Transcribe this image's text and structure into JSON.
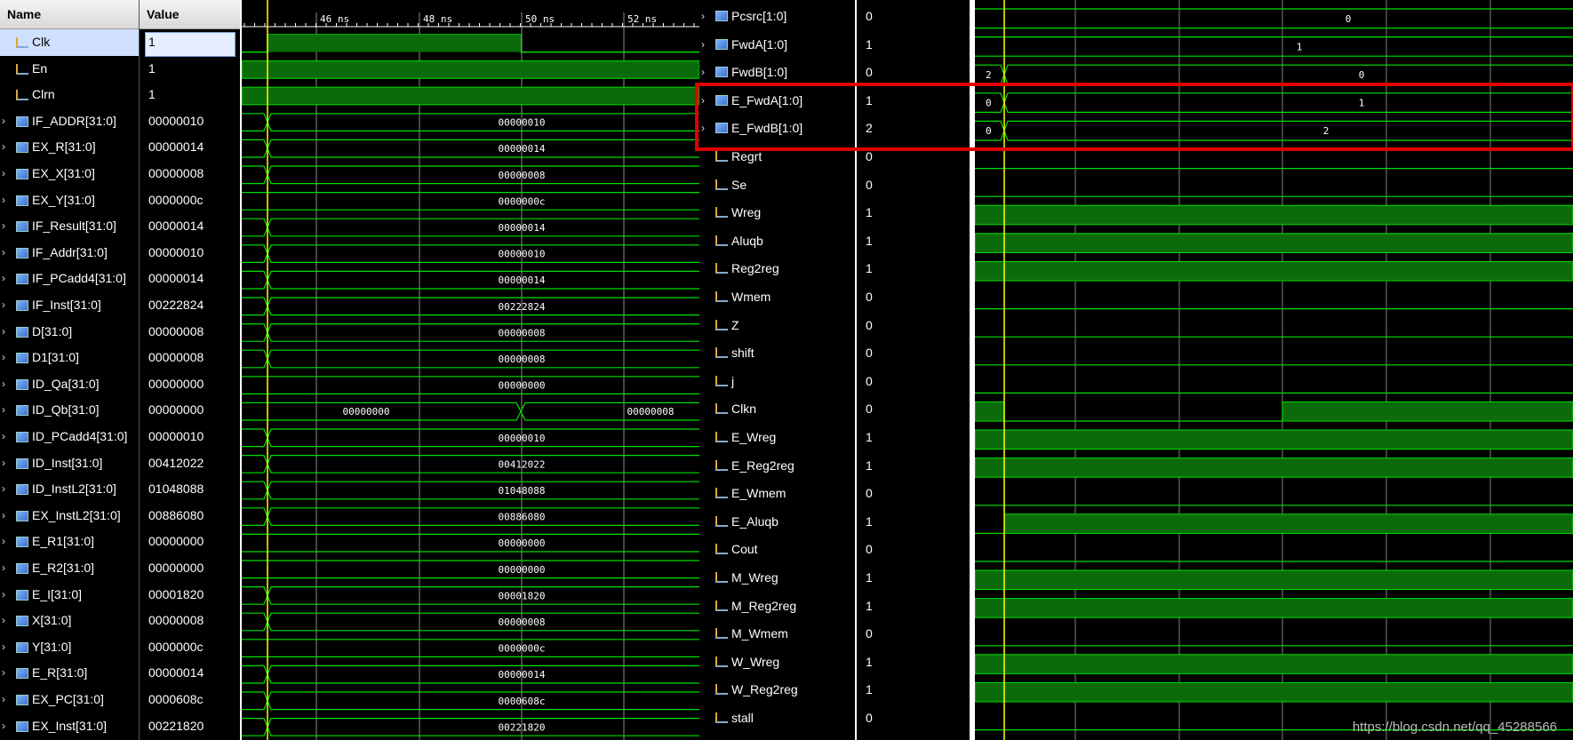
{
  "header": {
    "name_label": "Name",
    "value_label": "Value"
  },
  "timeline": {
    "ticks": [
      "46 ns",
      "48 ns",
      "50 ns",
      "52 ns"
    ]
  },
  "left_signals": [
    {
      "name": "Clk",
      "value": "1",
      "bus": false,
      "selected": true,
      "kind": "clk"
    },
    {
      "name": "En",
      "value": "1",
      "bus": false,
      "kind": "high"
    },
    {
      "name": "Clrn",
      "value": "1",
      "bus": false,
      "kind": "high"
    },
    {
      "name": "IF_ADDR[31:0]",
      "value": "00000010",
      "bus": true,
      "label": "00000010",
      "transition": true
    },
    {
      "name": "EX_R[31:0]",
      "value": "00000014",
      "bus": true,
      "label": "00000014",
      "transition": true
    },
    {
      "name": "EX_X[31:0]",
      "value": "00000008",
      "bus": true,
      "label": "00000008",
      "transition": true
    },
    {
      "name": "EX_Y[31:0]",
      "value": "0000000c",
      "bus": true,
      "label": "0000000c",
      "transition": false
    },
    {
      "name": "IF_Result[31:0]",
      "value": "00000014",
      "bus": true,
      "label": "00000014",
      "transition": true
    },
    {
      "name": "IF_Addr[31:0]",
      "value": "00000010",
      "bus": true,
      "label": "00000010",
      "transition": true
    },
    {
      "name": "IF_PCadd4[31:0]",
      "value": "00000014",
      "bus": true,
      "label": "00000014",
      "transition": true
    },
    {
      "name": "IF_Inst[31:0]",
      "value": "00222824",
      "bus": true,
      "label": "00222824",
      "transition": true
    },
    {
      "name": "D[31:0]",
      "value": "00000008",
      "bus": true,
      "label": "00000008",
      "transition": true
    },
    {
      "name": "D1[31:0]",
      "value": "00000008",
      "bus": true,
      "label": "00000008",
      "transition": true
    },
    {
      "name": "ID_Qa[31:0]",
      "value": "00000000",
      "bus": true,
      "label": "00000000",
      "transition": false
    },
    {
      "name": "ID_Qb[31:0]",
      "value": "00000000",
      "bus": true,
      "label": "00000000",
      "label2": "00000008",
      "split": true
    },
    {
      "name": "ID_PCadd4[31:0]",
      "value": "00000010",
      "bus": true,
      "label": "00000010",
      "transition": true
    },
    {
      "name": "ID_Inst[31:0]",
      "value": "00412022",
      "bus": true,
      "label": "00412022",
      "transition": true
    },
    {
      "name": "ID_InstL2[31:0]",
      "value": "01048088",
      "bus": true,
      "label": "01048088",
      "transition": true
    },
    {
      "name": "EX_InstL2[31:0]",
      "value": "00886080",
      "bus": true,
      "label": "00886080",
      "transition": true
    },
    {
      "name": "E_R1[31:0]",
      "value": "00000000",
      "bus": true,
      "label": "00000000",
      "transition": false
    },
    {
      "name": "E_R2[31:0]",
      "value": "00000000",
      "bus": true,
      "label": "00000000",
      "transition": false
    },
    {
      "name": "E_I[31:0]",
      "value": "00001820",
      "bus": true,
      "label": "00001820",
      "transition": true
    },
    {
      "name": "X[31:0]",
      "value": "00000008",
      "bus": true,
      "label": "00000008",
      "transition": true
    },
    {
      "name": "Y[31:0]",
      "value": "0000000c",
      "bus": true,
      "label": "0000000c",
      "transition": false
    },
    {
      "name": "E_R[31:0]",
      "value": "00000014",
      "bus": true,
      "label": "00000014",
      "transition": true
    },
    {
      "name": "EX_PC[31:0]",
      "value": "0000608c",
      "bus": true,
      "label": "0000608c",
      "transition": true
    },
    {
      "name": "EX_Inst[31:0]",
      "value": "00221820",
      "bus": true,
      "label": "00221820",
      "transition": true
    }
  ],
  "right_signals": [
    {
      "name": "Pcsrc[1:0]",
      "value": "0",
      "bus": true,
      "label": "0"
    },
    {
      "name": "FwdA[1:0]",
      "value": "1",
      "bus": true,
      "label": "1"
    },
    {
      "name": "FwdB[1:0]",
      "value": "0",
      "bus": true,
      "label": "0",
      "pre": "2"
    },
    {
      "name": "E_FwdA[1:0]",
      "value": "1",
      "bus": true,
      "label": "1",
      "pre": "0"
    },
    {
      "name": "E_FwdB[1:0]",
      "value": "2",
      "bus": true,
      "label": "2",
      "pre": "0"
    },
    {
      "name": "Regrt",
      "value": "0",
      "bus": false,
      "kind": "low"
    },
    {
      "name": "Se",
      "value": "0",
      "bus": false,
      "kind": "low"
    },
    {
      "name": "Wreg",
      "value": "1",
      "bus": false,
      "kind": "high"
    },
    {
      "name": "Aluqb",
      "value": "1",
      "bus": false,
      "kind": "high"
    },
    {
      "name": "Reg2reg",
      "value": "1",
      "bus": false,
      "kind": "high"
    },
    {
      "name": "Wmem",
      "value": "0",
      "bus": false,
      "kind": "low"
    },
    {
      "name": "Z",
      "value": "0",
      "bus": false,
      "kind": "low"
    },
    {
      "name": "shift",
      "value": "0",
      "bus": false,
      "kind": "low"
    },
    {
      "name": "j",
      "value": "0",
      "bus": false,
      "kind": "low"
    },
    {
      "name": "Clkn",
      "value": "0",
      "bus": false,
      "kind": "clkn"
    },
    {
      "name": "E_Wreg",
      "value": "1",
      "bus": false,
      "kind": "high"
    },
    {
      "name": "E_Reg2reg",
      "value": "1",
      "bus": false,
      "kind": "high"
    },
    {
      "name": "E_Wmem",
      "value": "0",
      "bus": false,
      "kind": "low"
    },
    {
      "name": "E_Aluqb",
      "value": "1",
      "bus": false,
      "kind": "rise"
    },
    {
      "name": "Cout",
      "value": "0",
      "bus": false,
      "kind": "low"
    },
    {
      "name": "M_Wreg",
      "value": "1",
      "bus": false,
      "kind": "high"
    },
    {
      "name": "M_Reg2reg",
      "value": "1",
      "bus": false,
      "kind": "high"
    },
    {
      "name": "M_Wmem",
      "value": "0",
      "bus": false,
      "kind": "low"
    },
    {
      "name": "W_Wreg",
      "value": "1",
      "bus": false,
      "kind": "high"
    },
    {
      "name": "W_Reg2reg",
      "value": "1",
      "bus": false,
      "kind": "high"
    },
    {
      "name": "stall",
      "value": "0",
      "bus": false,
      "kind": "low"
    }
  ],
  "highlight_box_label": "E_FwdA / E_FwdB",
  "watermark": "https://blog.csdn.net/qq_45288566",
  "colors": {
    "wave": "#00e000",
    "fill": "#0b6b0b",
    "cursor": "#ffff00",
    "highlight": "#e00000"
  }
}
